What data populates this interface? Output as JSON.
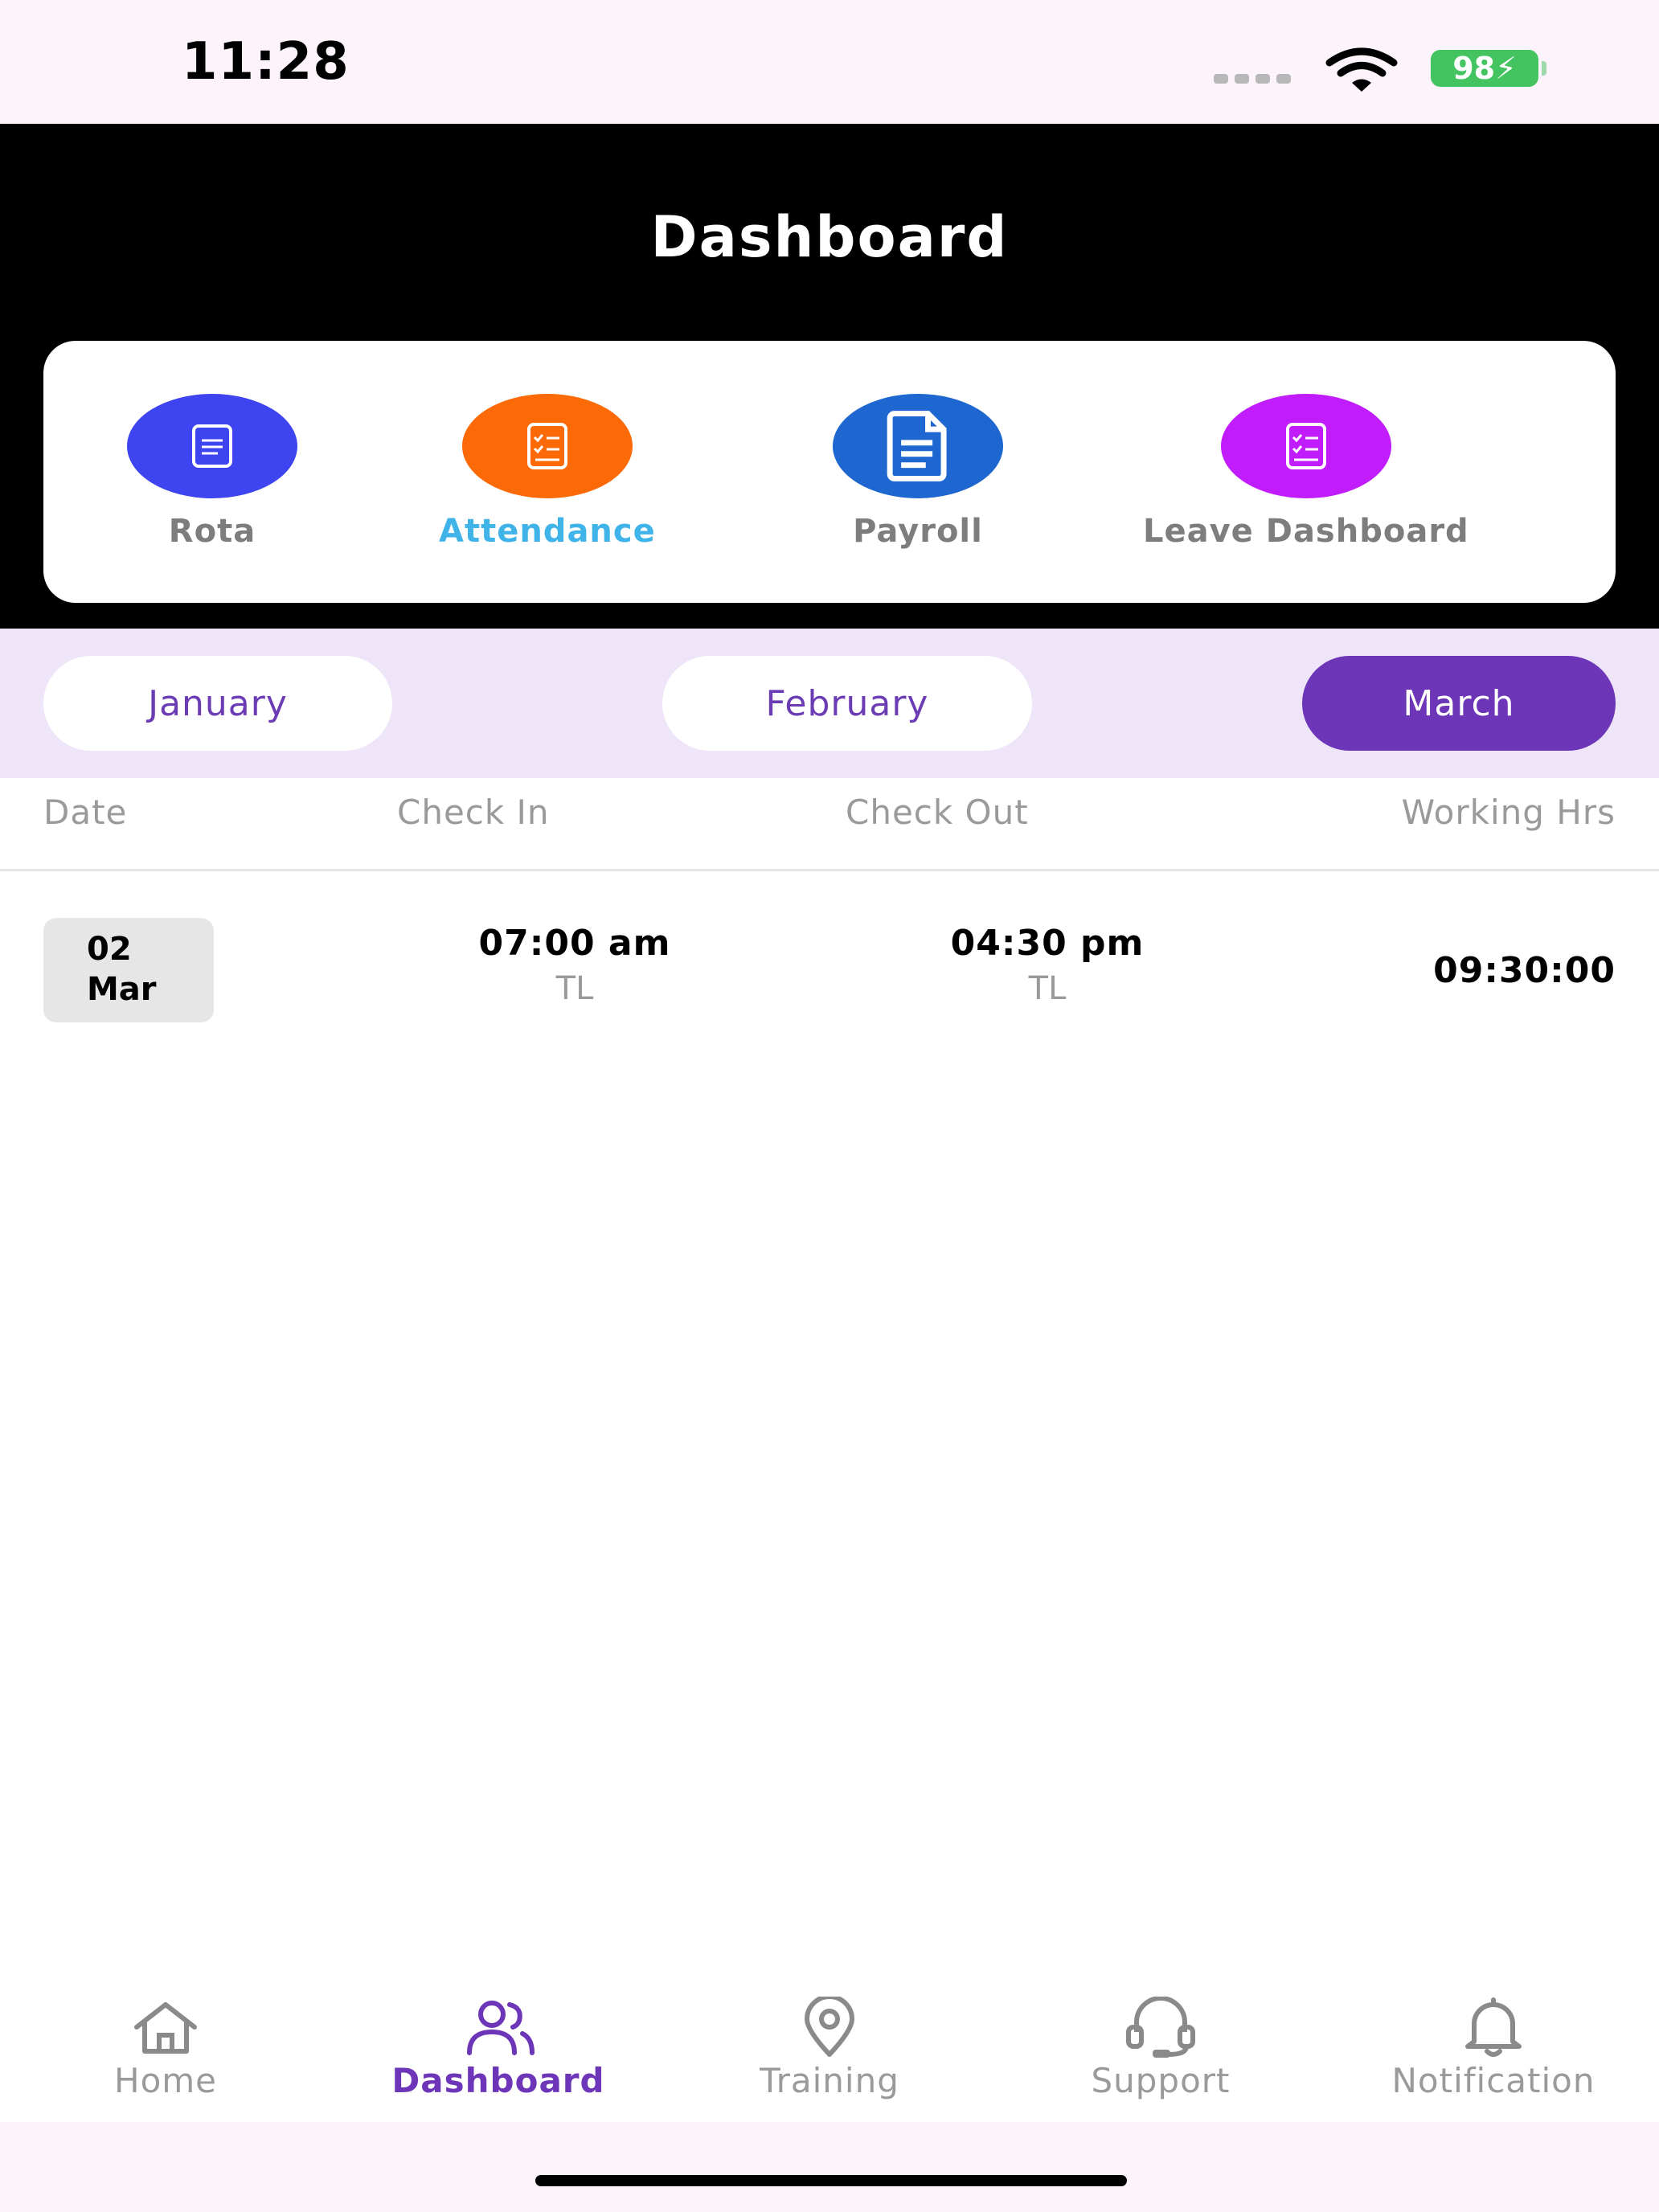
{
  "status_bar": {
    "time": "11:28",
    "battery": "98"
  },
  "header": {
    "title": "Dashboard"
  },
  "quick_actions": [
    {
      "label": "Rota",
      "color": "#3d44f0",
      "icon": "document-icon"
    },
    {
      "label": "Attendance",
      "color": "#fc6a08",
      "icon": "checklist-document-icon",
      "active": true
    },
    {
      "label": "Payroll",
      "color": "#1f67d0",
      "icon": "document-icon"
    },
    {
      "label": "Leave Dashboard",
      "color": "#c11cfb",
      "icon": "checklist-document-icon"
    }
  ],
  "months": [
    {
      "label": "January"
    },
    {
      "label": "February"
    },
    {
      "label": "March",
      "selected": true
    }
  ],
  "table": {
    "headers": [
      "Date",
      "Check In",
      "Check Out",
      "Working Hrs"
    ],
    "rows": [
      {
        "day": "02",
        "month": "Mar",
        "check_in": "07:00 am",
        "check_in_sub": "TL",
        "check_out": "04:30 pm",
        "check_out_sub": "TL",
        "working_hrs": "09:30:00"
      }
    ]
  },
  "bottom_nav": [
    {
      "label": "Home",
      "icon": "home-icon"
    },
    {
      "label": "Dashboard",
      "icon": "users-icon",
      "active": true
    },
    {
      "label": "Training",
      "icon": "location-pin-icon"
    },
    {
      "label": "Support",
      "icon": "headset-icon"
    },
    {
      "label": "Notification",
      "icon": "bell-icon"
    }
  ],
  "colors": {
    "accent": "#6d35b8",
    "active_link": "#40b4e8",
    "header_bg": "#000000",
    "months_bg": "#efe5f8"
  }
}
